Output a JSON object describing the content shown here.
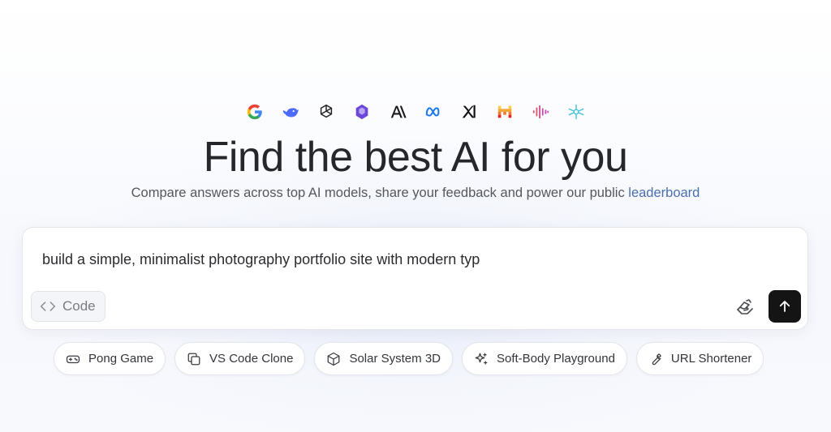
{
  "logos": [
    {
      "name": "google-logo-icon"
    },
    {
      "name": "deepseek-logo-icon"
    },
    {
      "name": "openai-logo-icon"
    },
    {
      "name": "mistral-style-logo-icon"
    },
    {
      "name": "anthropic-logo-icon",
      "text": "A\\"
    },
    {
      "name": "meta-logo-icon"
    },
    {
      "name": "xai-logo-icon",
      "text": "xI"
    },
    {
      "name": "mistral-logo-icon"
    },
    {
      "name": "audio-wave-logo-icon"
    },
    {
      "name": "network-logo-icon"
    }
  ],
  "hero": {
    "title": "Find the best AI for you",
    "subtitle": "Compare answers across top AI models, share your feedback and power our public ",
    "link": "leaderboard"
  },
  "composer": {
    "prompt": "build a simple, minimalist photography portfolio site with modern typ",
    "mode_label": "Code",
    "mode_icon": "code-brackets-icon",
    "attach_icon": "hand-upload-icon",
    "send_icon": "arrow-up-icon"
  },
  "suggestions": [
    {
      "label": "Pong Game",
      "icon": "gamepad-icon"
    },
    {
      "label": "VS Code Clone",
      "icon": "copy-icon"
    },
    {
      "label": "Solar System 3D",
      "icon": "cube-icon"
    },
    {
      "label": "Soft-Body Playground",
      "icon": "sparkles-icon"
    },
    {
      "label": "URL Shortener",
      "icon": "wrench-icon"
    }
  ],
  "colors": {
    "accent_link": "#4a6fb0",
    "send_button": "#141414",
    "headline": "#26272b"
  }
}
